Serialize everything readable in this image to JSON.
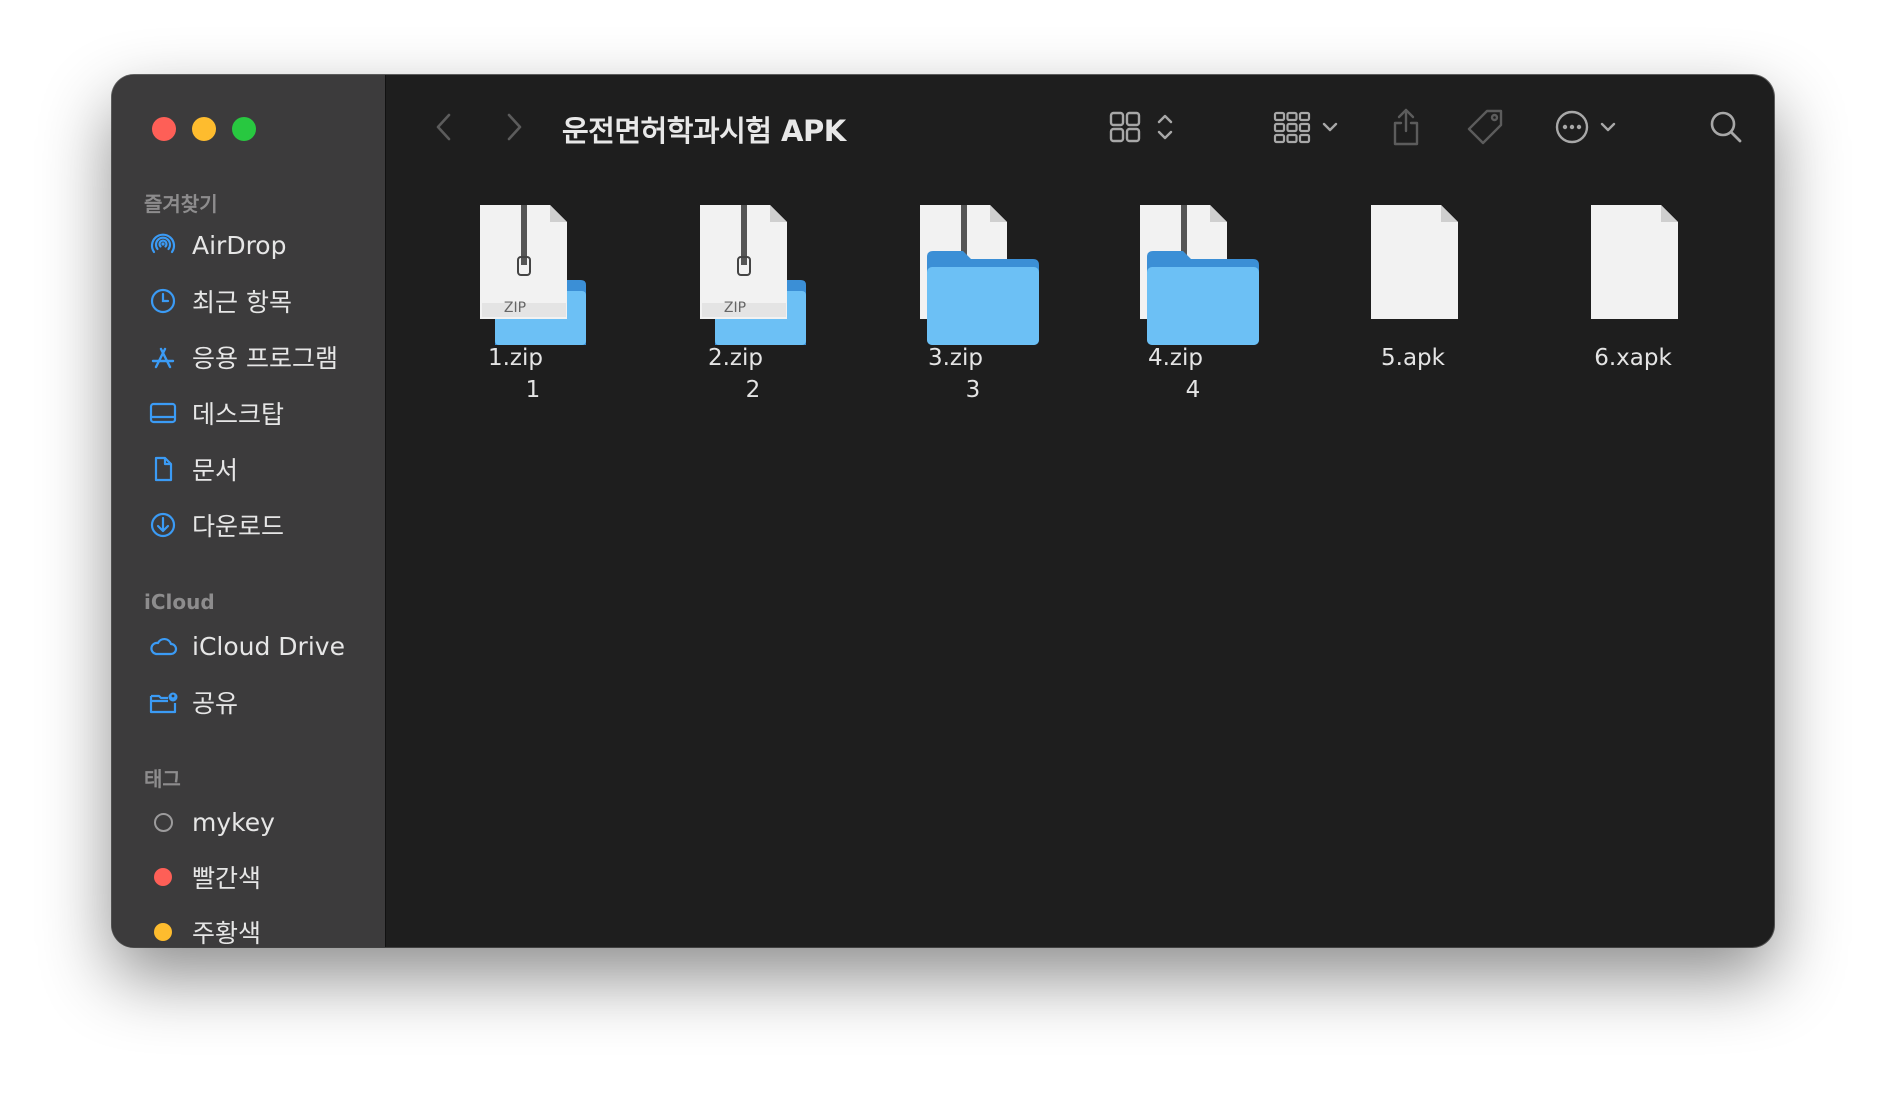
{
  "window": {
    "title": "운전면허학과시험 APK"
  },
  "sidebar": {
    "favorites_title": "즐겨찾기",
    "favorites": [
      {
        "label": "AirDrop",
        "icon": "airdrop-icon"
      },
      {
        "label": "최근 항목",
        "icon": "clock-icon"
      },
      {
        "label": "응용 프로그램",
        "icon": "applications-icon"
      },
      {
        "label": "데스크탑",
        "icon": "desktop-icon"
      },
      {
        "label": "문서",
        "icon": "document-icon"
      },
      {
        "label": "다운로드",
        "icon": "download-icon"
      }
    ],
    "icloud_title": "iCloud",
    "icloud": [
      {
        "label": "iCloud Drive",
        "icon": "cloud-icon"
      },
      {
        "label": "공유",
        "icon": "shared-folder-icon"
      }
    ],
    "tags_title": "태그",
    "tags": [
      {
        "label": "mykey",
        "color": "none"
      },
      {
        "label": "빨간색",
        "color": "#fe5f57"
      },
      {
        "label": "주황색",
        "color": "#febc2e"
      }
    ]
  },
  "files": [
    {
      "name": "1.zip",
      "sub": "1",
      "type": "zip-folder",
      "zip_label": "ZIP"
    },
    {
      "name": "2.zip",
      "sub": "2",
      "type": "zip-folder",
      "zip_label": "ZIP"
    },
    {
      "name": "3.zip",
      "sub": "3",
      "type": "zip-folder-big"
    },
    {
      "name": "4.zip",
      "sub": "4",
      "type": "zip-folder-big"
    },
    {
      "name": "5.apk",
      "sub": "",
      "type": "document"
    },
    {
      "name": "6.xapk",
      "sub": "",
      "type": "document"
    }
  ],
  "colors": {
    "folder_blue": "#6cc0f5",
    "accent_blue": "#3b9bf5"
  }
}
